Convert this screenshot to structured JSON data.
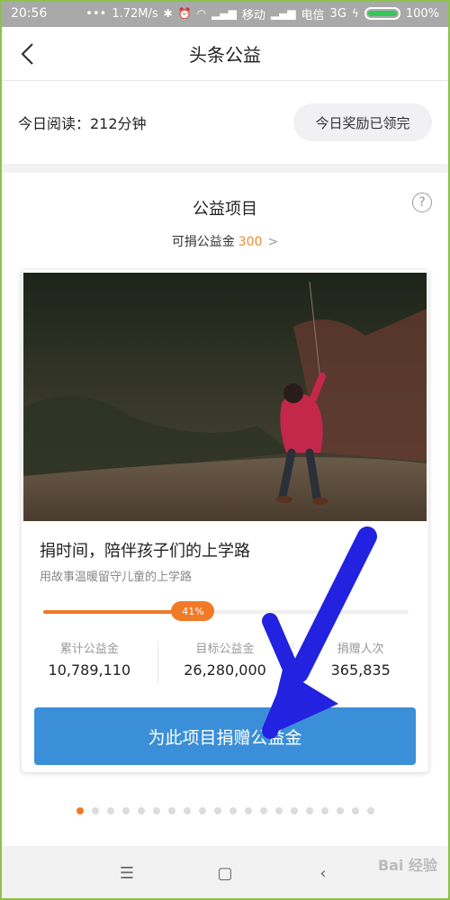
{
  "status_bar": {
    "time": "20:56",
    "net_speed": "1.72M/s",
    "carrier1": "移动",
    "carrier2": "电信",
    "network": "3G",
    "battery": "100%"
  },
  "header": {
    "title": "头条公益"
  },
  "reading": {
    "label": "今日阅读：212分钟",
    "reward_button": "今日奖励已领完"
  },
  "section": {
    "title": "公益项目",
    "help_glyph": "?",
    "available_label": "可捐公益金",
    "available_value": "300",
    "chevron": ">"
  },
  "project": {
    "title": "捐时间，陪伴孩子们的上学路",
    "subtitle": "用故事温暖留守儿童的上学路",
    "progress_percent": 41,
    "progress_label": "41%",
    "stats": [
      {
        "label": "累计公益金",
        "value": "10,789,110"
      },
      {
        "label": "目标公益金",
        "value": "26,280,000"
      },
      {
        "label": "捐赠人次",
        "value": "365,835"
      }
    ],
    "donate_button": "为此项目捐赠公益金"
  },
  "pagination": {
    "count": 20,
    "active": 0
  },
  "watermark": "Bai 经验",
  "colors": {
    "accent_orange": "#f07a28",
    "button_blue": "#3a8fd8",
    "annotation_arrow": "#2222e0"
  }
}
